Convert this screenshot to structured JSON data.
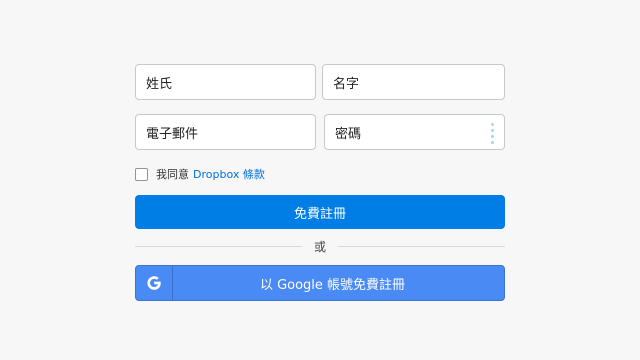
{
  "form": {
    "first_name_placeholder": "姓氏",
    "last_name_placeholder": "名字",
    "email_placeholder": "電子郵件",
    "password_placeholder": "密碼",
    "agree_text": "我同意",
    "terms_link": "Dropbox 條款",
    "signup_button": "免費註冊",
    "or_text": "或",
    "google_button": "以 Google 帳號免費註冊"
  },
  "colors": {
    "primary": "#007ee5",
    "google": "#4a8af4",
    "link": "#0070e0"
  },
  "icons": {
    "google": "google-icon",
    "password_manager": "password-manager-icon"
  }
}
